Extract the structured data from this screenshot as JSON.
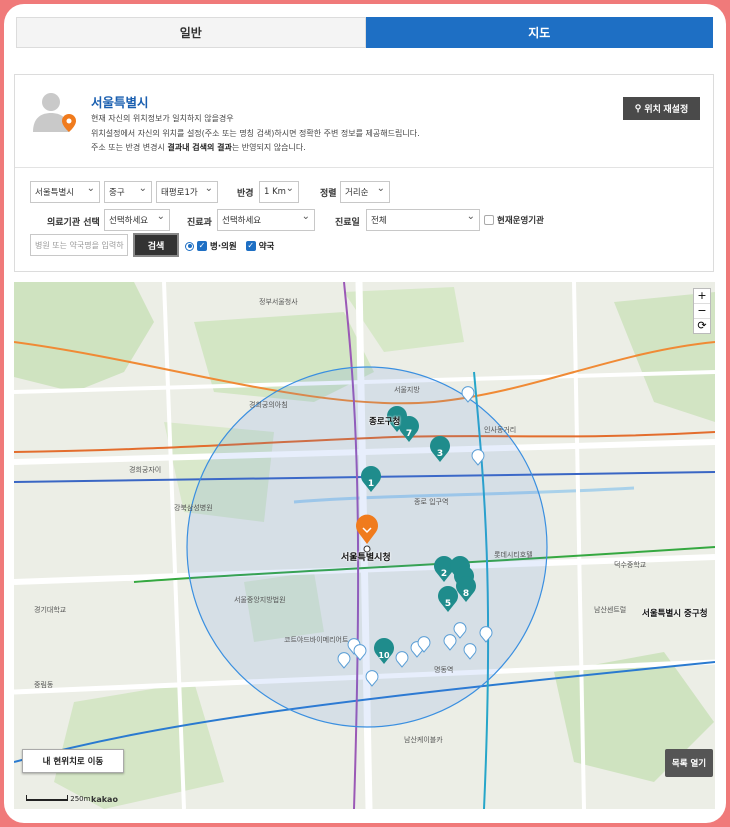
{
  "tabs": [
    {
      "label": "일반",
      "active": false
    },
    {
      "label": "지도",
      "active": true
    }
  ],
  "location": {
    "title": "서울특별시",
    "desc_line1": "현재 자신의 위치정보가 일치하지 않을경우",
    "desc_line2": "위치설정에서 자신의 위치를 설정(주소 또는 명칭 검색)하시면 정확한 주변 정보를 제공해드립니다.",
    "desc_line3_pre": "주소 또는 반경 변경시 ",
    "desc_line3_bold": "결과내 검색의 결과",
    "desc_line3_post": "는 반영되지 않습니다.",
    "reset_label": "위치 재설정"
  },
  "filters": {
    "city": "서울특별시",
    "district": "중구",
    "dong": "태평로1가",
    "radius_label": "반경",
    "radius": "1 Km",
    "sort_label": "정렬",
    "sort": "거리순",
    "type_label": "의료기관 선택",
    "type": "선택하세요",
    "dept_label": "진료과",
    "dept": "선택하세요",
    "day_label": "진료일",
    "day": "전체",
    "open_now": "현재운영기관",
    "search_placeholder": "병원 또는 약국명을 입력하",
    "search_label": "검색",
    "hospital_label": "병·의원",
    "pharmacy_label": "약국"
  },
  "map": {
    "center_label": "서울특별시청",
    "my_location_label": "내 현위치로 이동",
    "list_open_label": "목록 열기",
    "scale_label": "250m",
    "brand_label": "kakao",
    "zoom_in": "+",
    "zoom_out": "−",
    "markers": [
      "1",
      "2",
      "3",
      "4",
      "5",
      "6",
      "7",
      "8",
      "9",
      "10"
    ],
    "district_label_1": "서울특별시 중구청",
    "district_label_2": "종로구청",
    "accent_color": "#1e6fc4",
    "marker_color": "#1f8c8c",
    "center_marker_color": "#f07b1d"
  }
}
